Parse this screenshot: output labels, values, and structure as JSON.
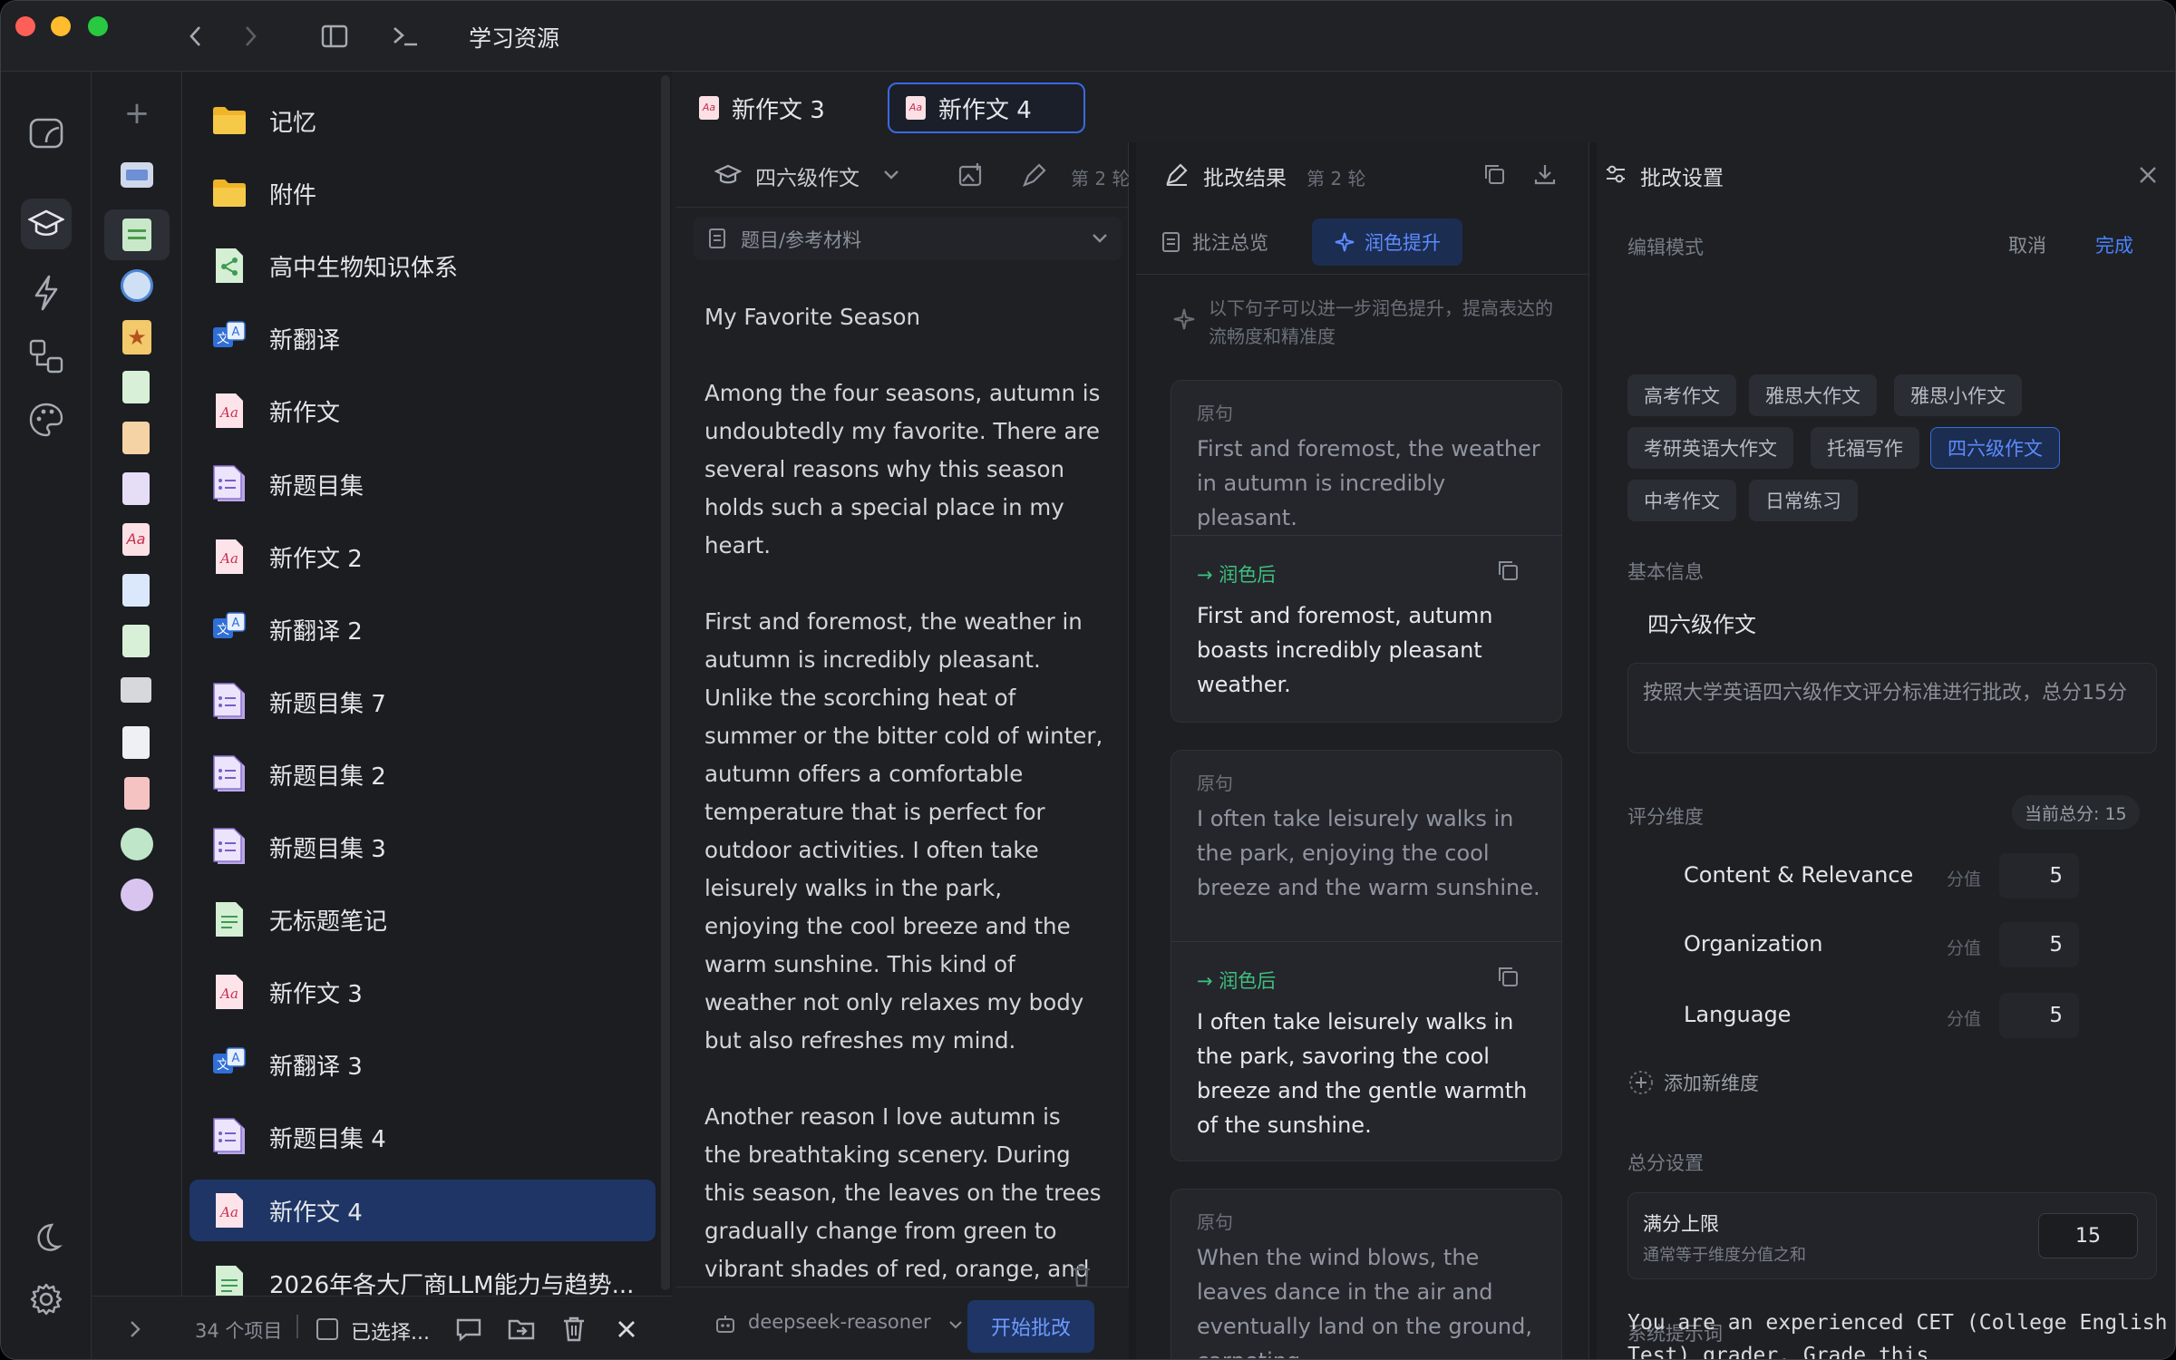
{
  "window": {
    "title": "学习资源"
  },
  "sidebar_files": [
    {
      "name": "记忆",
      "icon": "folder-icon"
    },
    {
      "name": "附件",
      "icon": "folder-icon"
    },
    {
      "name": "高中生物知识体系",
      "icon": "mindmap-file-icon"
    },
    {
      "name": "新翻译",
      "icon": "translate-file-icon"
    },
    {
      "name": "新作文",
      "icon": "essay-file-icon"
    },
    {
      "name": "新题目集",
      "icon": "question-set-file-icon"
    },
    {
      "name": "新作文 2",
      "icon": "essay-file-icon"
    },
    {
      "name": "新翻译 2",
      "icon": "translate-file-icon"
    },
    {
      "name": "新题目集 7",
      "icon": "question-set-file-icon"
    },
    {
      "name": "新题目集 2",
      "icon": "question-set-file-icon"
    },
    {
      "name": "新题目集 3",
      "icon": "question-set-file-icon"
    },
    {
      "name": "无标题笔记",
      "icon": "note-file-icon"
    },
    {
      "name": "新作文 3",
      "icon": "essay-file-icon"
    },
    {
      "name": "新翻译 3",
      "icon": "translate-file-icon"
    },
    {
      "name": "新题目集 4",
      "icon": "question-set-file-icon"
    },
    {
      "name": "新作文 4",
      "icon": "essay-file-icon",
      "active": true
    },
    {
      "name": "2026年各大厂商LLM能力与趋势...",
      "icon": "note-file-icon"
    }
  ],
  "bottombar": {
    "count": "34 个项目",
    "selected": "已选择..."
  },
  "tabs": [
    {
      "label": "新作文 3"
    },
    {
      "label": "新作文 4",
      "active": true
    }
  ],
  "editor": {
    "essay_type": "四六级作文",
    "round": "第 2 轮",
    "reference": "题目/参考材料",
    "paragraphs": [
      "My Favorite Season",
      "Among the four seasons, autumn is undoubtedly my favorite. There are several reasons why this season holds such a special place in my heart.",
      "First and foremost, the weather in autumn is incredibly pleasant. Unlike the scorching heat of summer or the bitter cold of winter, autumn offers a comfortable temperature that is perfect for outdoor activities. I often take leisurely walks in the park, enjoying the cool breeze and the warm sunshine. This kind of weather not only relaxes my body but also refreshes my mind.",
      "Another reason I love autumn is the breathtaking scenery. During this season, the leaves on the trees gradually change from green to vibrant shades of red, orange, and yellow. When the wind blows, the leaves"
    ],
    "model": "deepseek-reasoner",
    "start_button": "开始批改"
  },
  "results": {
    "title": "批改结果",
    "round": "第 2 轮",
    "tab_overview": "批注总览",
    "tab_polish": "润色提升",
    "hint": "以下句子可以进一步润色提升，提高表达的流畅度和精准度",
    "label_original": "原句",
    "label_polished": "润色后",
    "items": [
      {
        "original": "First and foremost, the weather in autumn is incredibly pleasant.",
        "polished": "First and foremost, autumn boasts incredibly pleasant weather."
      },
      {
        "original": "I often take leisurely walks in the park, enjoying the cool breeze and the warm sunshine.",
        "polished": "I often take leisurely walks in the park, savoring the cool breeze and the gentle warmth of the sunshine."
      },
      {
        "original": "When the wind blows, the leaves dance in the air and eventually land on the ground, carpeting",
        "polished": ""
      }
    ]
  },
  "settings": {
    "title": "批改设置",
    "edit_mode": "编辑模式",
    "cancel": "取消",
    "done": "完成",
    "chips": [
      "高考作文",
      "雅思大作文",
      "雅思小作文",
      "考研英语大作文",
      "托福写作",
      "四六级作文",
      "中考作文",
      "日常练习"
    ],
    "selected_chip": "四六级作文",
    "basic_info": "基本信息",
    "name_value": "四六级作文",
    "description": "按照大学英语四六级作文评分标准进行批改，总分15分",
    "dimensions_label": "评分维度",
    "current_total": "当前总分: 15",
    "score_label": "分值",
    "dimensions": [
      {
        "name": "Content & Relevance",
        "score": "5"
      },
      {
        "name": "Organization",
        "score": "5"
      },
      {
        "name": "Language",
        "score": "5"
      }
    ],
    "add_dimension": "添加新维度",
    "total_settings": "总分设置",
    "max_label": "满分上限",
    "max_hint": "通常等于维度分值之和",
    "max_value": "15",
    "system_prompt_label": "系统提示词",
    "system_prompt": "You are an experienced CET (College English Test) grader. Grade this"
  },
  "colors": {
    "accent": "#3a6ae0",
    "green": "#3fbf7f",
    "active_row": "#1e3566"
  }
}
